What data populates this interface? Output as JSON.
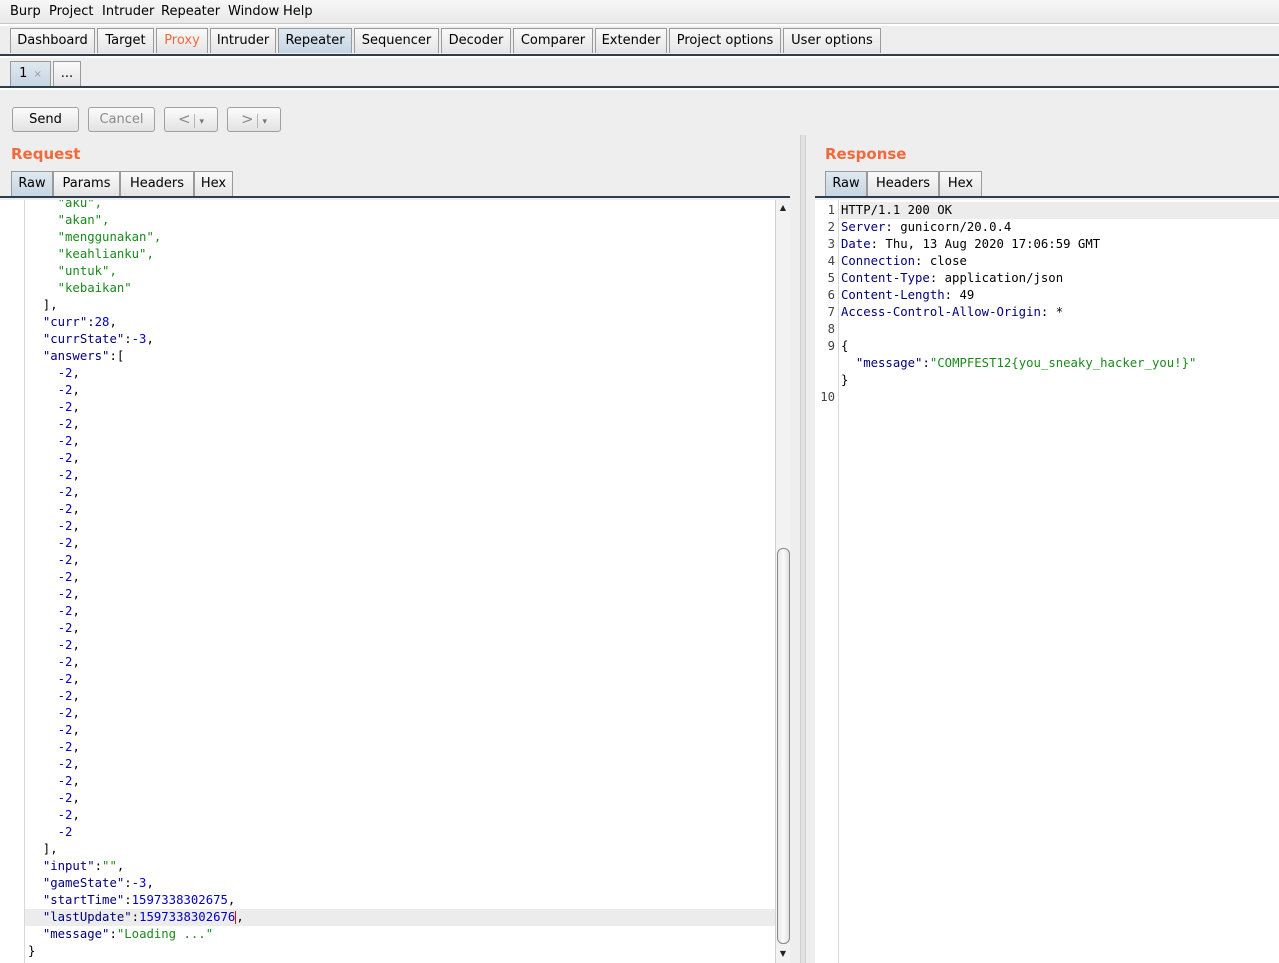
{
  "menu": [
    "Burp",
    "Project",
    "Intruder",
    "Repeater",
    "Window",
    "Help"
  ],
  "main_tabs": [
    "Dashboard",
    "Target",
    "Proxy",
    "Intruder",
    "Repeater",
    "Sequencer",
    "Decoder",
    "Comparer",
    "Extender",
    "Project options",
    "User options"
  ],
  "repeater_tabs": {
    "tab1": "1",
    "tab1_close": "×",
    "more": "..."
  },
  "toolbar": {
    "send": "Send",
    "cancel": "Cancel",
    "back": "<",
    "forward": ">",
    "dropdown": "▾"
  },
  "request": {
    "title": "Request",
    "tabs": [
      "Raw",
      "Params",
      "Headers",
      "Hex"
    ],
    "lines": [
      [
        [
          "    ",
          ""
        ],
        [
          "\"aku\",",
          "s"
        ]
      ],
      [
        [
          "    ",
          ""
        ],
        [
          "\"akan\",",
          "s"
        ]
      ],
      [
        [
          "    ",
          ""
        ],
        [
          "\"menggunakan\",",
          "s"
        ]
      ],
      [
        [
          "    ",
          ""
        ],
        [
          "\"keahlianku\",",
          "s"
        ]
      ],
      [
        [
          "    ",
          ""
        ],
        [
          "\"untuk\",",
          "s"
        ]
      ],
      [
        [
          "    ",
          ""
        ],
        [
          "\"kebaikan\"",
          "s"
        ]
      ],
      [
        [
          "  ],",
          ""
        ]
      ],
      [
        [
          "  ",
          ""
        ],
        [
          "\"curr\"",
          "k"
        ],
        [
          ":",
          ""
        ],
        [
          "28",
          "n"
        ],
        [
          ",",
          ""
        ]
      ],
      [
        [
          "  ",
          ""
        ],
        [
          "\"currState\"",
          "k"
        ],
        [
          ":",
          ""
        ],
        [
          "-3",
          "n"
        ],
        [
          ",",
          ""
        ]
      ],
      [
        [
          "  ",
          ""
        ],
        [
          "\"answers\"",
          "k"
        ],
        [
          ":[",
          ""
        ]
      ],
      [
        [
          "    ",
          ""
        ],
        [
          "-2",
          "n"
        ],
        [
          ",",
          ""
        ]
      ],
      [
        [
          "    ",
          ""
        ],
        [
          "-2",
          "n"
        ],
        [
          ",",
          ""
        ]
      ],
      [
        [
          "    ",
          ""
        ],
        [
          "-2",
          "n"
        ],
        [
          ",",
          ""
        ]
      ],
      [
        [
          "    ",
          ""
        ],
        [
          "-2",
          "n"
        ],
        [
          ",",
          ""
        ]
      ],
      [
        [
          "    ",
          ""
        ],
        [
          "-2",
          "n"
        ],
        [
          ",",
          ""
        ]
      ],
      [
        [
          "    ",
          ""
        ],
        [
          "-2",
          "n"
        ],
        [
          ",",
          ""
        ]
      ],
      [
        [
          "    ",
          ""
        ],
        [
          "-2",
          "n"
        ],
        [
          ",",
          ""
        ]
      ],
      [
        [
          "    ",
          ""
        ],
        [
          "-2",
          "n"
        ],
        [
          ",",
          ""
        ]
      ],
      [
        [
          "    ",
          ""
        ],
        [
          "-2",
          "n"
        ],
        [
          ",",
          ""
        ]
      ],
      [
        [
          "    ",
          ""
        ],
        [
          "-2",
          "n"
        ],
        [
          ",",
          ""
        ]
      ],
      [
        [
          "    ",
          ""
        ],
        [
          "-2",
          "n"
        ],
        [
          ",",
          ""
        ]
      ],
      [
        [
          "    ",
          ""
        ],
        [
          "-2",
          "n"
        ],
        [
          ",",
          ""
        ]
      ],
      [
        [
          "    ",
          ""
        ],
        [
          "-2",
          "n"
        ],
        [
          ",",
          ""
        ]
      ],
      [
        [
          "    ",
          ""
        ],
        [
          "-2",
          "n"
        ],
        [
          ",",
          ""
        ]
      ],
      [
        [
          "    ",
          ""
        ],
        [
          "-2",
          "n"
        ],
        [
          ",",
          ""
        ]
      ],
      [
        [
          "    ",
          ""
        ],
        [
          "-2",
          "n"
        ],
        [
          ",",
          ""
        ]
      ],
      [
        [
          "    ",
          ""
        ],
        [
          "-2",
          "n"
        ],
        [
          ",",
          ""
        ]
      ],
      [
        [
          "    ",
          ""
        ],
        [
          "-2",
          "n"
        ],
        [
          ",",
          ""
        ]
      ],
      [
        [
          "    ",
          ""
        ],
        [
          "-2",
          "n"
        ],
        [
          ",",
          ""
        ]
      ],
      [
        [
          "    ",
          ""
        ],
        [
          "-2",
          "n"
        ],
        [
          ",",
          ""
        ]
      ],
      [
        [
          "    ",
          ""
        ],
        [
          "-2",
          "n"
        ],
        [
          ",",
          ""
        ]
      ],
      [
        [
          "    ",
          ""
        ],
        [
          "-2",
          "n"
        ],
        [
          ",",
          ""
        ]
      ],
      [
        [
          "    ",
          ""
        ],
        [
          "-2",
          "n"
        ],
        [
          ",",
          ""
        ]
      ],
      [
        [
          "    ",
          ""
        ],
        [
          "-2",
          "n"
        ],
        [
          ",",
          ""
        ]
      ],
      [
        [
          "    ",
          ""
        ],
        [
          "-2",
          "n"
        ],
        [
          ",",
          ""
        ]
      ],
      [
        [
          "    ",
          ""
        ],
        [
          "-2",
          "n"
        ],
        [
          ",",
          ""
        ]
      ],
      [
        [
          "    ",
          ""
        ],
        [
          "-2",
          "n"
        ],
        [
          ",",
          ""
        ]
      ],
      [
        [
          "    ",
          ""
        ],
        [
          "-2",
          "n"
        ]
      ],
      [
        [
          "  ],",
          ""
        ]
      ],
      [
        [
          "  ",
          ""
        ],
        [
          "\"input\"",
          "k"
        ],
        [
          ":",
          ""
        ],
        [
          "\"\"",
          "s"
        ],
        [
          ",",
          ""
        ]
      ],
      [
        [
          "  ",
          ""
        ],
        [
          "\"gameState\"",
          "k"
        ],
        [
          ":",
          ""
        ],
        [
          "-3",
          "n"
        ],
        [
          ",",
          ""
        ]
      ],
      [
        [
          "  ",
          ""
        ],
        [
          "\"startTime\"",
          "k"
        ],
        [
          ":",
          ""
        ],
        [
          "1597338302675",
          "n"
        ],
        [
          ",",
          ""
        ]
      ],
      [
        [
          "  ",
          ""
        ],
        [
          "\"lastUpdate\"",
          "k"
        ],
        [
          ":",
          ""
        ],
        [
          "1597338302676",
          "n"
        ],
        [
          ",",
          ""
        ]
      ],
      [
        [
          "  ",
          ""
        ],
        [
          "\"message\"",
          "k"
        ],
        [
          ":",
          ""
        ],
        [
          "\"Loading ...\"",
          "s"
        ]
      ],
      [
        [
          "}",
          ""
        ]
      ]
    ]
  },
  "response": {
    "title": "Response",
    "tabs": [
      "Raw",
      "Headers",
      "Hex"
    ],
    "line_numbers": [
      "1",
      "2",
      "3",
      "4",
      "5",
      "6",
      "7",
      "8",
      "9",
      "",
      "",
      "10"
    ],
    "lines": [
      [
        [
          "HTTP/1.1 200 OK",
          ""
        ]
      ],
      [
        [
          "Server",
          "k"
        ],
        [
          ": gunicorn/20.0.4",
          ""
        ]
      ],
      [
        [
          "Date",
          "k"
        ],
        [
          ": Thu, 13 Aug 2020 17:06:59 GMT",
          ""
        ]
      ],
      [
        [
          "Connection",
          "k"
        ],
        [
          ": close",
          ""
        ]
      ],
      [
        [
          "Content-Type",
          "k"
        ],
        [
          ": application/json",
          ""
        ]
      ],
      [
        [
          "Content-Length",
          "k"
        ],
        [
          ": 49",
          ""
        ]
      ],
      [
        [
          "Access-Control-Allow-Origin",
          "k"
        ],
        [
          ": *",
          ""
        ]
      ],
      [
        [
          "",
          ""
        ]
      ],
      [
        [
          "{",
          ""
        ]
      ],
      [
        [
          "  ",
          ""
        ],
        [
          "\"message\"",
          "k"
        ],
        [
          ":",
          ""
        ],
        [
          "\"COMPFEST12{you_sneaky_hacker_you!}\"",
          "s"
        ]
      ],
      [
        [
          "}",
          ""
        ]
      ],
      [
        [
          "",
          ""
        ]
      ]
    ]
  },
  "colors": {
    "accent": "#f26a3c",
    "string": "#1a8a1a",
    "number": "#0000c8",
    "key": "#00007a",
    "tab_underline": "#2c3e50"
  }
}
